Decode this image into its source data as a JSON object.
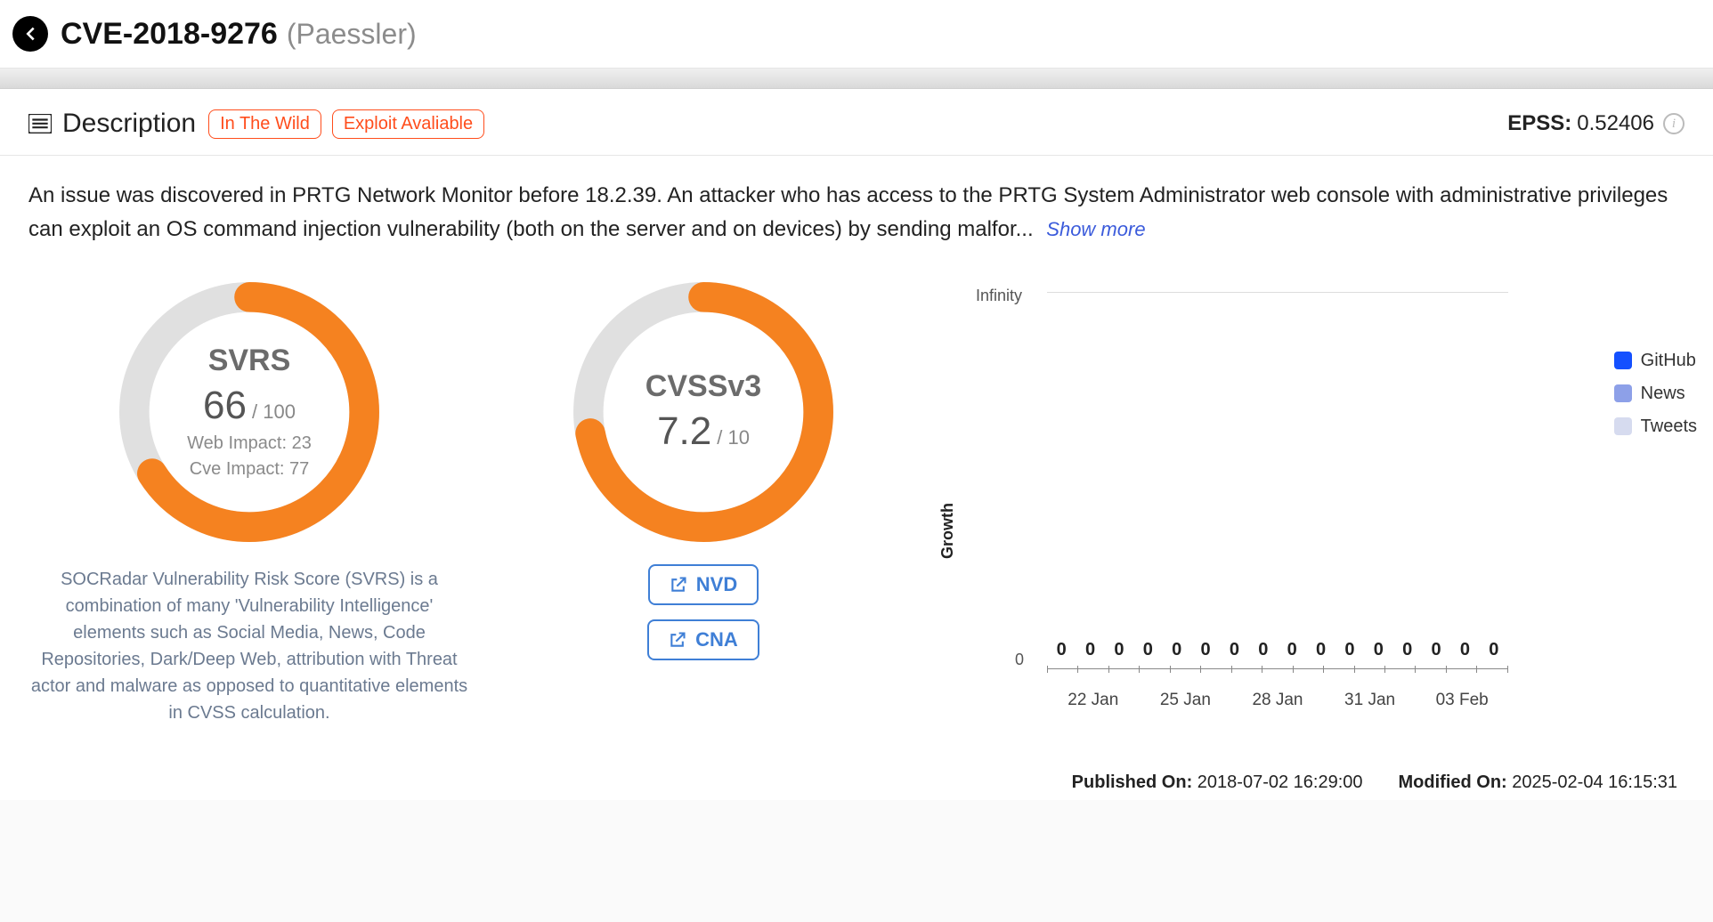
{
  "header": {
    "cve_id": "CVE-2018-9276",
    "vendor": "(Paessler)"
  },
  "section": {
    "title": "Description",
    "badges": {
      "in_the_wild": "In The Wild",
      "exploit": "Exploit Avaliable"
    },
    "epss_label": "EPSS:",
    "epss_value": "0.52406"
  },
  "description": {
    "text": "An issue was discovered in PRTG Network Monitor before 18.2.39. An attacker who has access to the PRTG System Administrator web console with administrative privileges can exploit an OS command injection vulnerability (both on the server and on devices) by sending malfor...",
    "show_more": "Show more"
  },
  "svrs": {
    "title": "SVRS",
    "value": "66",
    "max_label": "/ 100",
    "web_impact": "Web Impact: 23",
    "cve_impact": "Cve Impact: 77",
    "pct": 66,
    "desc": "SOCRadar Vulnerability Risk Score (SVRS) is a combination of many 'Vulnerability Intelligence' elements such as Social Media, News, Code Repositories, Dark/Deep Web, attribution with Threat actor and malware as opposed to quantitative elements in CVSS calculation."
  },
  "cvss": {
    "title": "CVSSv3",
    "value": "7.2",
    "max_label": "/ 10",
    "pct": 72,
    "links": {
      "nvd": "NVD",
      "cna": "CNA"
    }
  },
  "growth": {
    "y_top": "Infinity",
    "y_bottom": "0",
    "axis_label": "Growth",
    "x_ticks": [
      "22 Jan",
      "25 Jan",
      "28 Jan",
      "31 Jan",
      "03 Feb"
    ],
    "bar_values": [
      "0",
      "0",
      "0",
      "0",
      "0",
      "0",
      "0",
      "0",
      "0",
      "0",
      "0",
      "0",
      "0",
      "0",
      "0",
      "0"
    ],
    "legend": [
      {
        "label": "GitHub",
        "color": "#1450ff"
      },
      {
        "label": "News",
        "color": "#8da0e8"
      },
      {
        "label": "Tweets",
        "color": "#d6dbef"
      }
    ]
  },
  "chart_data": {
    "type": "bar",
    "title": "Growth",
    "xlabel": "",
    "ylabel": "Growth",
    "x_ticks": [
      "22 Jan",
      "25 Jan",
      "28 Jan",
      "31 Jan",
      "03 Feb"
    ],
    "y_ticks": [
      "0",
      "Infinity"
    ],
    "categories_count": 16,
    "series": [
      {
        "name": "GitHub",
        "values": [
          0,
          0,
          0,
          0,
          0,
          0,
          0,
          0,
          0,
          0,
          0,
          0,
          0,
          0,
          0,
          0
        ]
      },
      {
        "name": "News",
        "values": [
          0,
          0,
          0,
          0,
          0,
          0,
          0,
          0,
          0,
          0,
          0,
          0,
          0,
          0,
          0,
          0
        ]
      },
      {
        "name": "Tweets",
        "values": [
          0,
          0,
          0,
          0,
          0,
          0,
          0,
          0,
          0,
          0,
          0,
          0,
          0,
          0,
          0,
          0
        ]
      }
    ]
  },
  "footer": {
    "published_label": "Published On:",
    "published_value": "2018-07-02 16:29:00",
    "modified_label": "Modified On:",
    "modified_value": "2025-02-04 16:15:31"
  }
}
